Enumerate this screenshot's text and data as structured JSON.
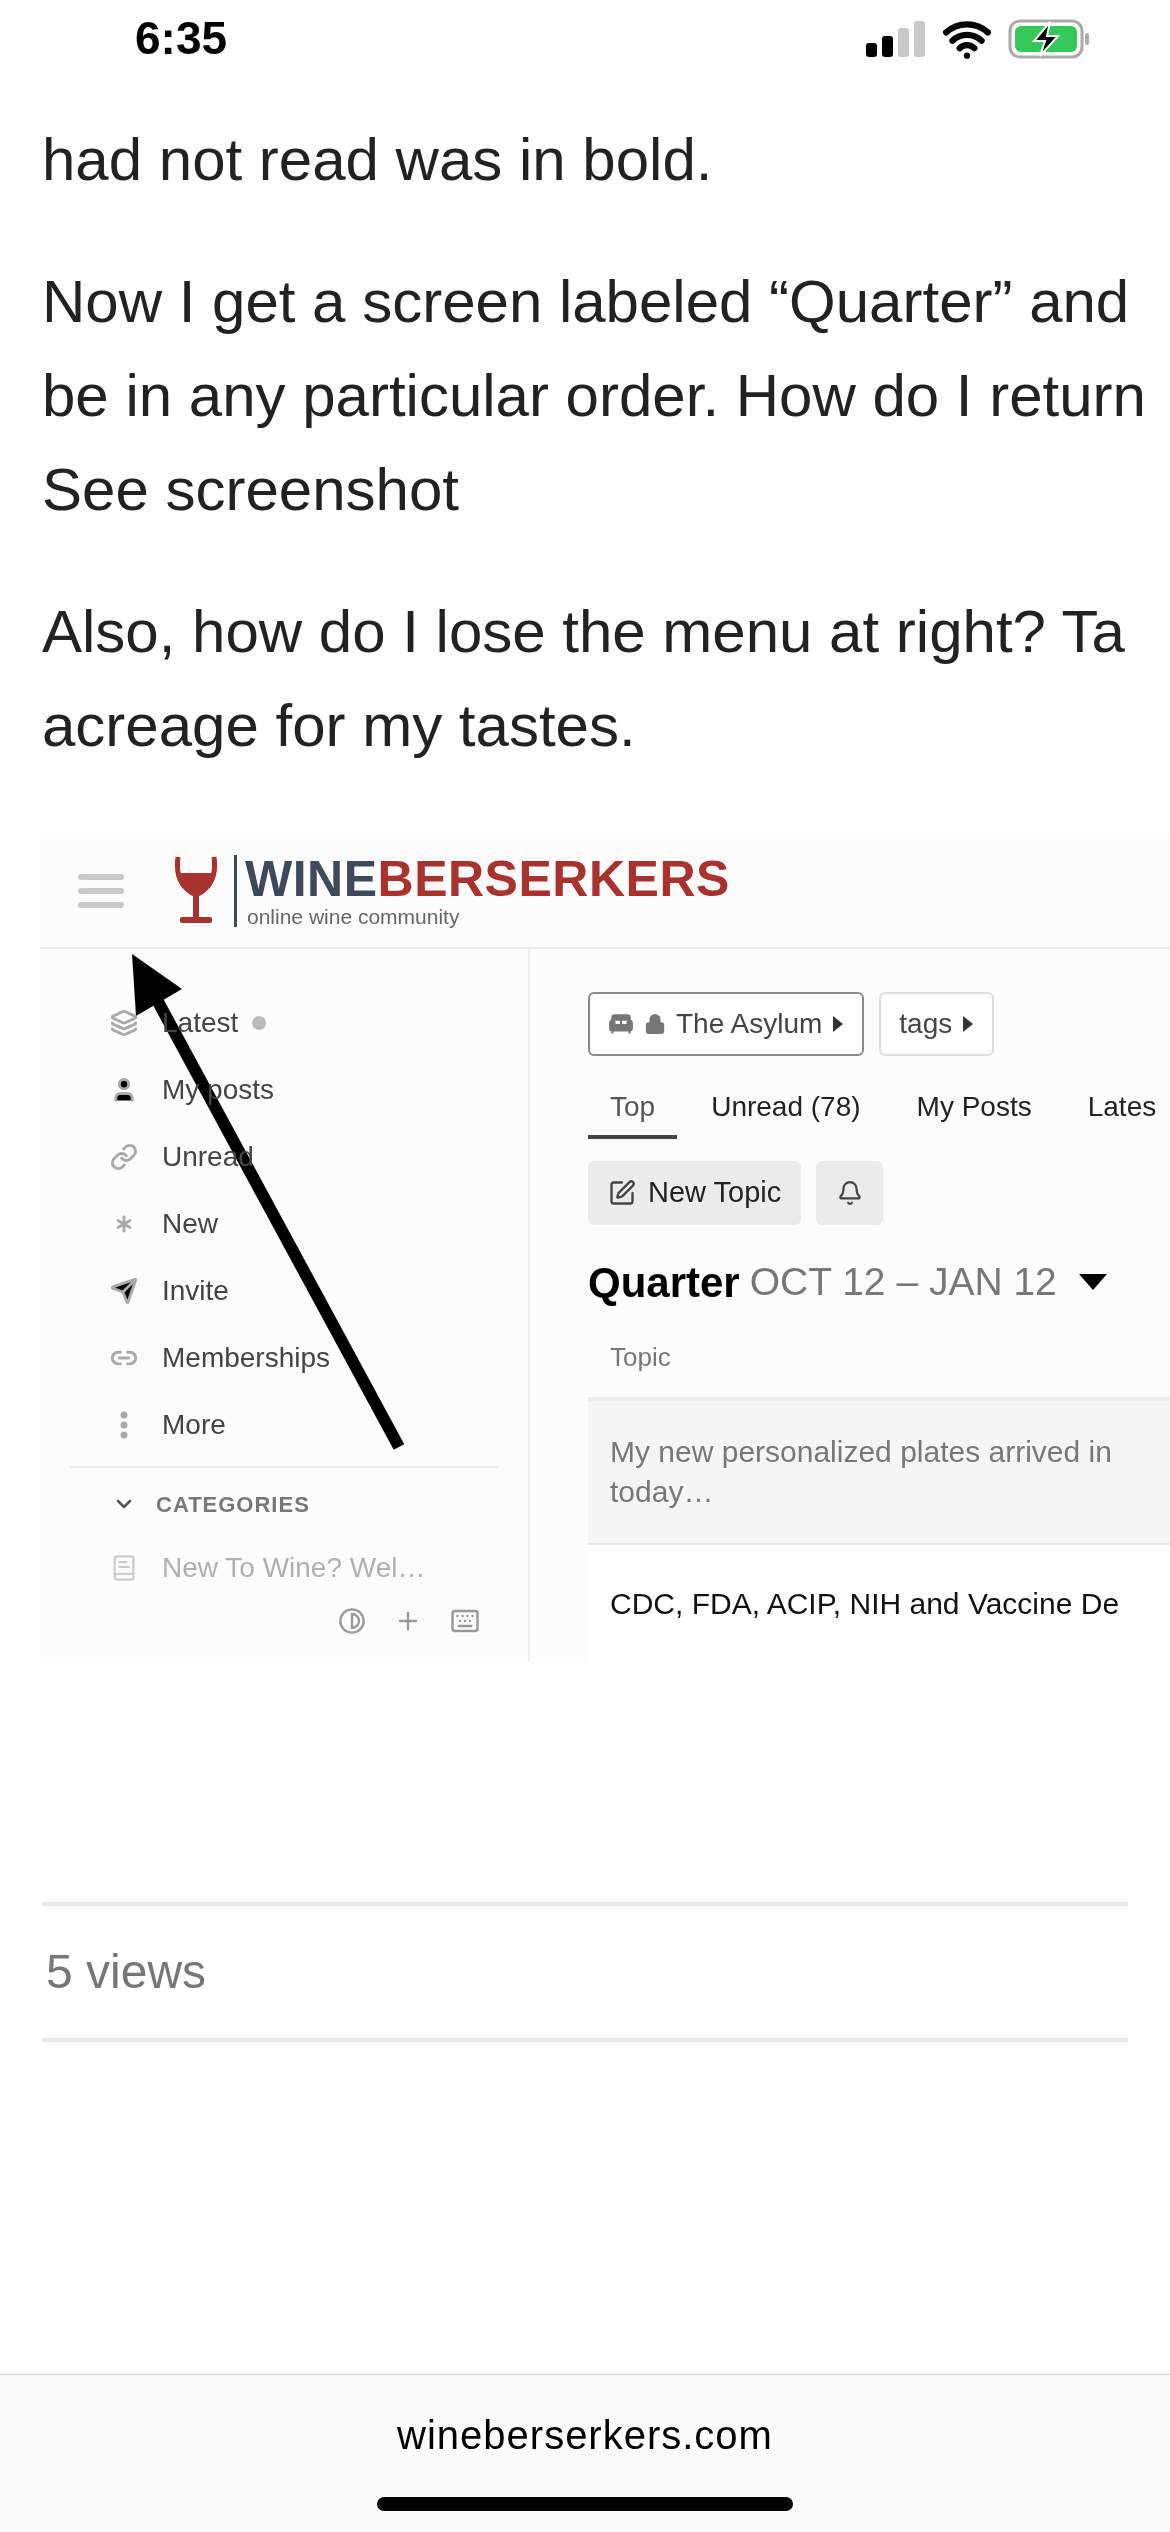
{
  "status_bar": {
    "time": "6:35"
  },
  "post": {
    "paragraphs": [
      [
        "had not read was in bold."
      ],
      [
        "Now I get a screen labeled “Quarter” and",
        "be in any particular order. How do I return",
        "See screenshot"
      ],
      [
        "Also, how do I lose the menu at right? Ta",
        "acreage for my tastes."
      ]
    ]
  },
  "screenshot": {
    "logo": {
      "wordmark_dark": "WINE",
      "wordmark_red": "BERSERKERS",
      "tagline": "online wine community"
    },
    "sidebar": {
      "items": [
        {
          "label": "Latest",
          "dot": true
        },
        {
          "label": "My posts",
          "dot": false
        },
        {
          "label": "Unread",
          "dot": false
        },
        {
          "label": "New",
          "dot": false
        },
        {
          "label": "Invite",
          "dot": false
        },
        {
          "label": "Memberships",
          "dot": false
        },
        {
          "label": "More",
          "dot": false
        }
      ],
      "section": {
        "label": "CATEGORIES",
        "expanded": true
      },
      "categories": [
        "New To Wine? Wel…"
      ]
    },
    "breadcrumbs": [
      "The Asylum",
      "tags"
    ],
    "tabs": [
      {
        "label": "Top",
        "selected": true
      },
      {
        "label": "Unread (78)",
        "selected": false
      },
      {
        "label": "My Posts",
        "selected": false
      },
      {
        "label": "Lates",
        "selected": false
      }
    ],
    "new_topic": "New Topic",
    "period": {
      "title": "Quarter",
      "range": "OCT 12 – JAN 12"
    },
    "topic_header": "Topic",
    "topics": [
      {
        "title": "My new personalized plates arrived in today…",
        "highlighted": true
      },
      {
        "title": "CDC, FDA, ACIP, NIH and Vaccine De",
        "highlighted": false
      }
    ]
  },
  "views": "5 views",
  "browser": {
    "domain": "wineberserkers.com"
  }
}
